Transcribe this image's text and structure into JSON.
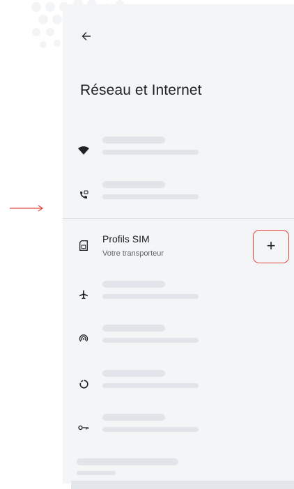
{
  "header": {
    "title": "Réseau et Internet",
    "back_icon": "arrow-back-icon"
  },
  "rows": [
    {
      "icon": "wifi-icon",
      "placeholder": true
    },
    {
      "icon": "wifi-calling-icon",
      "placeholder": true
    },
    {
      "icon": "sim-card-icon",
      "title": "Profils SIM",
      "subtitle": "Votre transporteur"
    },
    {
      "icon": "airplane-icon",
      "placeholder": true
    },
    {
      "icon": "hotspot-icon",
      "placeholder": true
    },
    {
      "icon": "data-saver-icon",
      "placeholder": true
    },
    {
      "icon": "vpn-key-icon",
      "placeholder": true
    }
  ],
  "sim_action": {
    "label": "+",
    "icon": "add-icon"
  },
  "colors": {
    "accent": "#e2463f",
    "panel": "#f4f5f7",
    "placeholder": "#e1e4e8",
    "text": "#202124"
  }
}
